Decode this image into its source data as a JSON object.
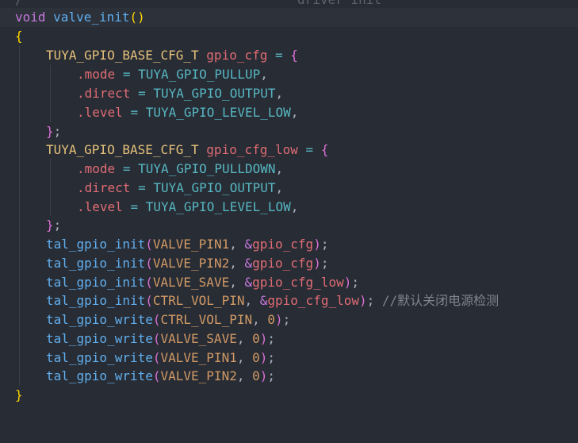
{
  "editor": {
    "top_partial": {
      "slash": "/",
      "text": "driver init"
    },
    "lines": [
      {
        "kw": "void",
        "fn": "valve_init",
        "open": "(",
        "close": ")"
      },
      {
        "brace": "{"
      },
      {
        "type": "TUYA_GPIO_BASE_CFG_T",
        "var": "gpio_cfg",
        "eq": "=",
        "open": "{"
      },
      {
        "field": ".mode",
        "eq": "=",
        "val": "TUYA_GPIO_PULLUP",
        "end": ","
      },
      {
        "field": ".direct",
        "eq": "=",
        "val": "TUYA_GPIO_OUTPUT",
        "end": ","
      },
      {
        "field": ".level",
        "eq": "=",
        "val": "TUYA_GPIO_LEVEL_LOW",
        "end": ","
      },
      {
        "close": "}",
        "end": ";"
      },
      {
        "type": "TUYA_GPIO_BASE_CFG_T",
        "var": "gpio_cfg_low",
        "eq": "=",
        "open": "{"
      },
      {
        "field": ".mode",
        "eq": "=",
        "val": "TUYA_GPIO_PULLDOWN",
        "end": ","
      },
      {
        "field": ".direct",
        "eq": "=",
        "val": "TUYA_GPIO_OUTPUT",
        "end": ","
      },
      {
        "field": ".level",
        "eq": "=",
        "val": "TUYA_GPIO_LEVEL_LOW",
        "end": ","
      },
      {
        "close": "}",
        "end": ";"
      },
      {
        "fn": "tal_gpio_init",
        "open": "(",
        "arg1": "VALVE_PIN1",
        "comma": ",",
        "amp": "&",
        "arg2": "gpio_cfg",
        "close": ")",
        "end": ";"
      },
      {
        "fn": "tal_gpio_init",
        "open": "(",
        "arg1": "VALVE_PIN2",
        "comma": ",",
        "amp": "&",
        "arg2": "gpio_cfg",
        "close": ")",
        "end": ";"
      },
      {
        "fn": "tal_gpio_init",
        "open": "(",
        "arg1": "VALVE_SAVE",
        "comma": ",",
        "amp": "&",
        "arg2": "gpio_cfg_low",
        "close": ")",
        "end": ";"
      },
      {
        "fn": "tal_gpio_init",
        "open": "(",
        "arg1": "CTRL_VOL_PIN",
        "comma": ",",
        "amp": "&",
        "arg2": "gpio_cfg_low",
        "close": ")",
        "end": ";",
        "comment": "//默认关闭电源检测"
      },
      {
        "fn": "tal_gpio_write",
        "open": "(",
        "arg1": "CTRL_VOL_PIN",
        "comma": ",",
        "arg2": "0",
        "close": ")",
        "end": ";"
      },
      {
        "fn": "tal_gpio_write",
        "open": "(",
        "arg1": "VALVE_SAVE",
        "comma": ",",
        "arg2": "0",
        "close": ")",
        "end": ";"
      },
      {
        "fn": "tal_gpio_write",
        "open": "(",
        "arg1": "VALVE_PIN1",
        "comma": ",",
        "arg2": "0",
        "close": ")",
        "end": ";"
      },
      {
        "fn": "tal_gpio_write",
        "open": "(",
        "arg1": "VALVE_PIN2",
        "comma": ",",
        "arg2": "0",
        "close": ")",
        "end": ";"
      },
      {
        "brace": "}"
      }
    ]
  }
}
